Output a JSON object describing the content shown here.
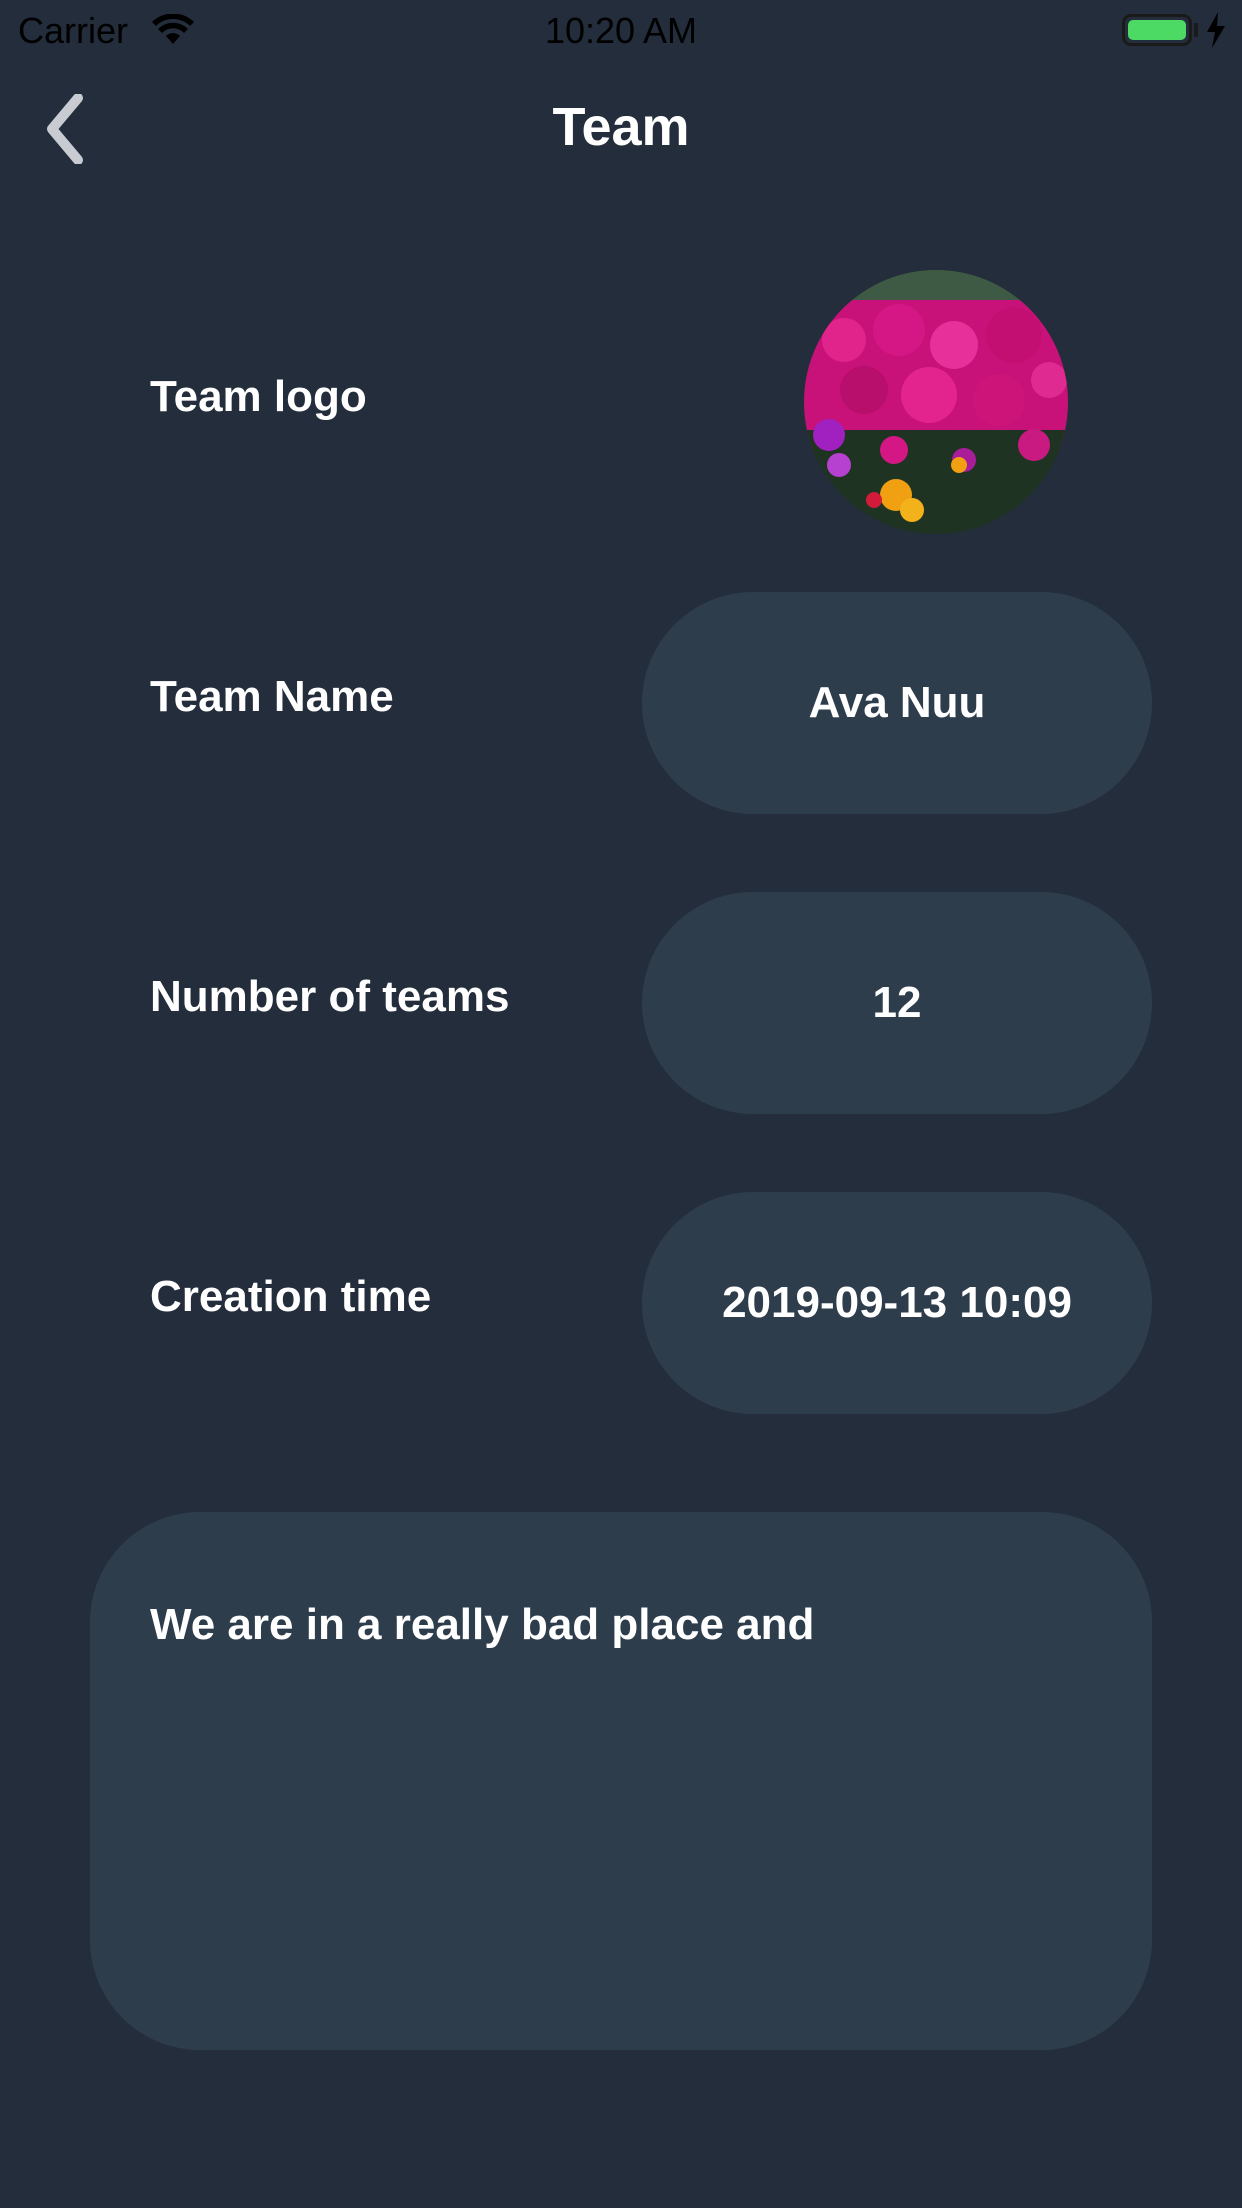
{
  "status_bar": {
    "carrier": "Carrier",
    "time": "10:20 AM",
    "battery_color": "#4cd964"
  },
  "nav": {
    "title": "Team",
    "back_icon": "chevron-left-icon"
  },
  "form": {
    "logo_label": "Team logo",
    "logo_image": "flower-field-photo",
    "name_label": "Team Name",
    "name_value": "Ava Nuu",
    "count_label": "Number of teams",
    "count_value": "12",
    "created_label": "Creation time",
    "created_value": "2019-09-13 10:09",
    "description": "We are in a really bad place and"
  },
  "colors": {
    "background": "#232d3b",
    "field": "#2e3d4c",
    "text": "#ffffff"
  }
}
